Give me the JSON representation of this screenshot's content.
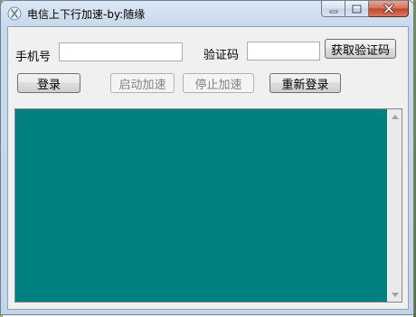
{
  "window": {
    "title": "电信上下行加速-by:随缘",
    "app_icon": "app-logo-icon",
    "caption_icons": [
      "minimize-icon",
      "maximize-icon",
      "close-icon"
    ]
  },
  "form": {
    "phone_label": "手机号",
    "phone_value": "",
    "code_label": "验证码",
    "code_value": "",
    "get_code_button": "获取验证码"
  },
  "actions": {
    "login": "登录",
    "start_accel": "启动加速",
    "stop_accel": "停止加速",
    "relogin": "重新登录"
  },
  "log": {
    "background": "#008080",
    "scroll_up_icon": "scroll-up-arrow-icon",
    "scroll_down_icon": "scroll-down-arrow-icon"
  },
  "colors": {
    "log_background": "#008080",
    "close_button": "#c2422a"
  }
}
